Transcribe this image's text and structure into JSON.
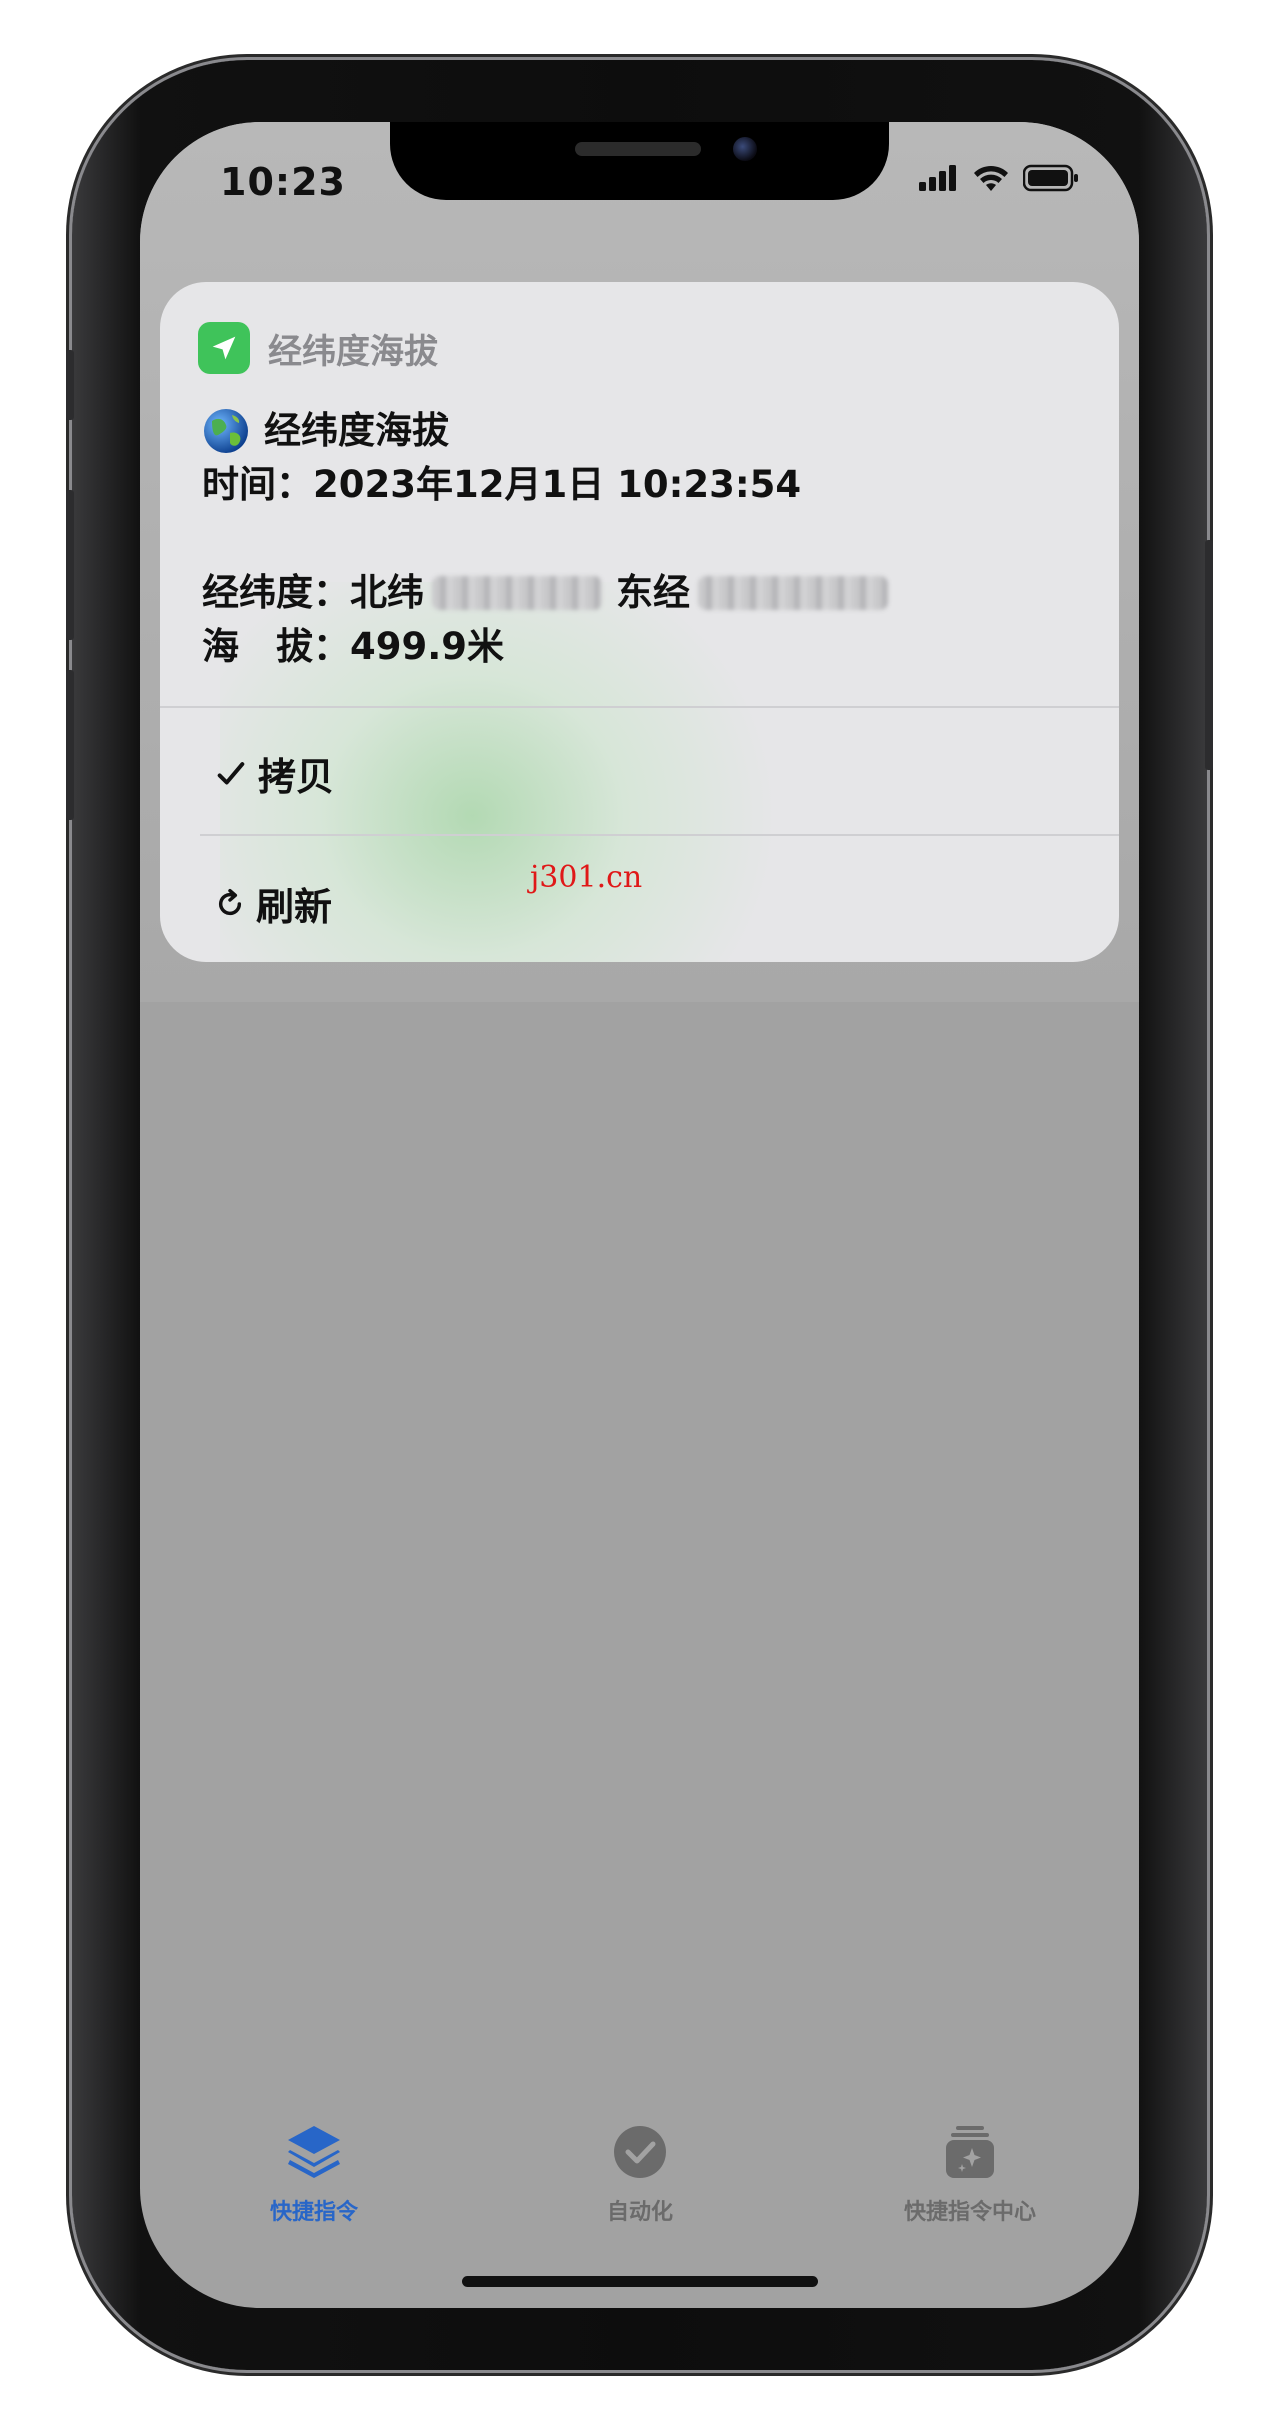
{
  "status_bar": {
    "time": "10:23"
  },
  "notification": {
    "app_name": "经纬度海拔",
    "title": "经纬度海拔",
    "time_line": "时间：2023年12月1日 10:23:54",
    "coord_label": "经纬度：北纬",
    "east_label": "东经",
    "altitude_line": "海　拔：499.9米",
    "actions": [
      {
        "icon": "checkmark-icon",
        "label": "拷贝"
      },
      {
        "icon": "refresh-icon",
        "label": "刷新"
      }
    ]
  },
  "watermark": "j301.cn",
  "tab_bar": {
    "tabs": [
      {
        "icon": "layers-icon",
        "label": "快捷指令",
        "active": true
      },
      {
        "icon": "clock-check-icon",
        "label": "自动化",
        "active": false
      },
      {
        "icon": "gallery-sparkle-icon",
        "label": "快捷指令中心",
        "active": false
      }
    ]
  },
  "colors": {
    "accent": "#2866c8",
    "app_icon": "#3fc35a",
    "watermark": "#e01818",
    "background_dim": "#a2a2a2"
  }
}
